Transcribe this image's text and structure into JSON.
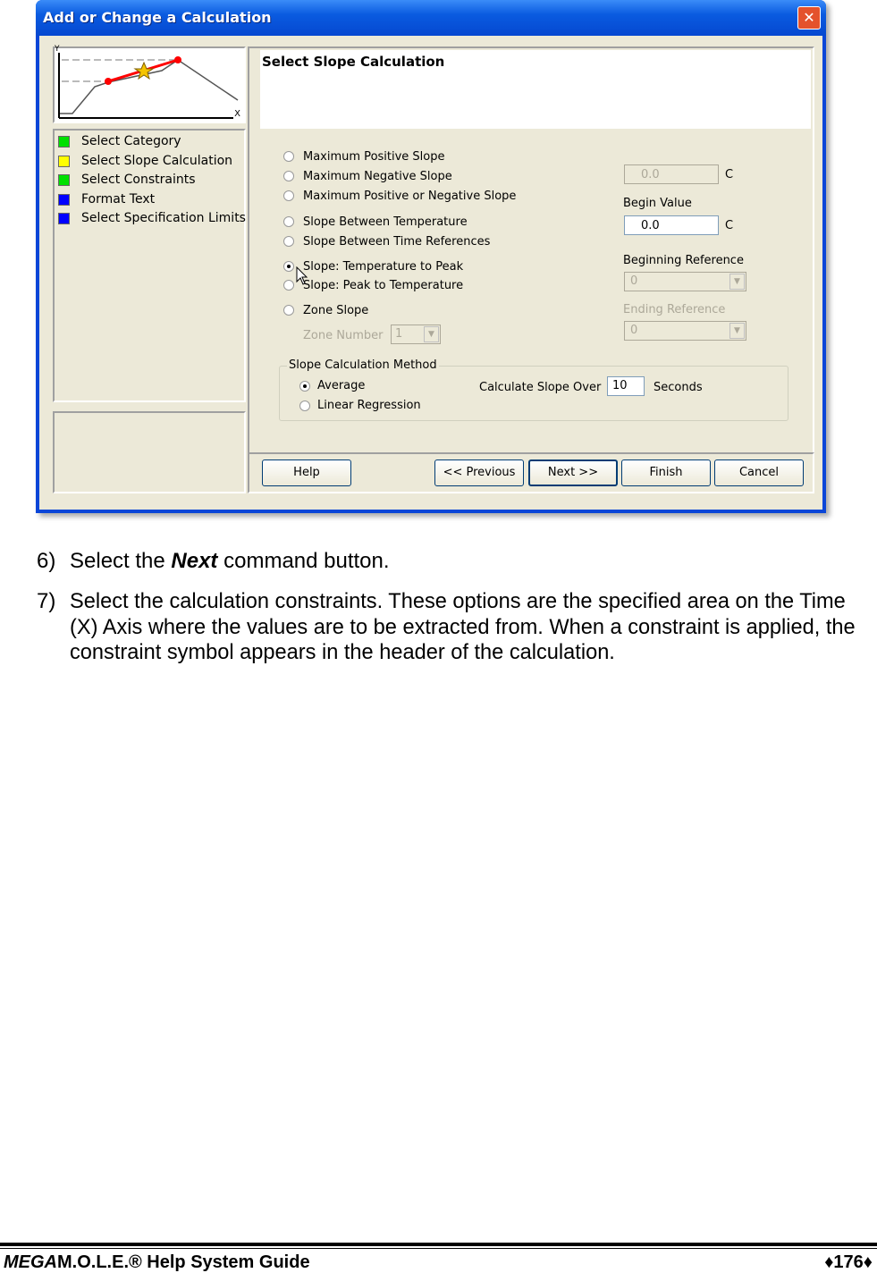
{
  "dialog": {
    "title": "Add or Change a Calculation",
    "header": "Select Slope Calculation"
  },
  "steps": [
    {
      "label": "Select Category",
      "color": "#00e000"
    },
    {
      "label": "Select Slope Calculation",
      "color": "#ffff00"
    },
    {
      "label": "Select Constraints",
      "color": "#00e000"
    },
    {
      "label": "Format Text",
      "color": "#0000ff"
    },
    {
      "label": "Select Specification Limits",
      "color": "#0000ff"
    }
  ],
  "graph": {
    "y_label": "Y",
    "x_label": "X"
  },
  "options": [
    {
      "label": "Maximum Positive Slope",
      "selected": false
    },
    {
      "label": "Maximum Negative Slope",
      "selected": false
    },
    {
      "label": "Maximum Positive or Negative Slope",
      "selected": false
    },
    {
      "label": "Slope Between Temperature",
      "selected": false
    },
    {
      "label": "Slope Between Time References",
      "selected": false
    },
    {
      "label": "Slope: Temperature to Peak",
      "selected": true
    },
    {
      "label": "Slope: Peak to Temperature",
      "selected": false
    },
    {
      "label": "Zone Slope",
      "selected": false
    }
  ],
  "zone": {
    "label": "Zone Number",
    "value": "1"
  },
  "fields": {
    "value1": "0.0",
    "unit1": "C",
    "begin_label": "Begin Value",
    "begin_value": "0.0",
    "unit2": "C",
    "beg_ref_label": "Beginning Reference",
    "beg_ref_value": "0",
    "end_ref_label": "Ending Reference",
    "end_ref_value": "0"
  },
  "method": {
    "legend": "Slope Calculation Method",
    "options": [
      {
        "label": "Average",
        "selected": true
      },
      {
        "label": "Linear Regression",
        "selected": false
      }
    ],
    "over_label": "Calculate Slope Over",
    "over_value": "10",
    "unit": "Seconds"
  },
  "buttons": {
    "help": "Help",
    "previous": "<< Previous",
    "next": "Next >>",
    "finish": "Finish",
    "cancel": "Cancel"
  },
  "doc": {
    "step6_num": "6)",
    "step6_pre": "Select the ",
    "step6_bold": "Next",
    "step6_post": " command button.",
    "step7_num": "7)",
    "step7_text": "Select the calculation constraints. These options are the specified area on the Time (X) Axis where the values are to be extracted from.  When a constraint is applied, the constraint symbol appears in the header of the calculation."
  },
  "footer": {
    "brand_italic": "MEGA",
    "brand_rest": "M.O.L.E.® Help System Guide",
    "page": "♦176♦"
  }
}
